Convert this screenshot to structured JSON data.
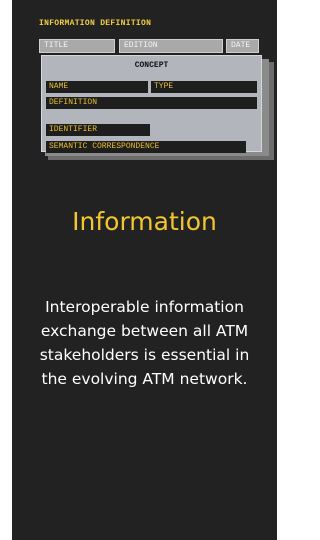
{
  "illustration": {
    "header": "INFORMATION DEFINITION",
    "top_fields": {
      "title": "TITLE",
      "edition": "EDITION",
      "date": "DATE"
    },
    "concept_title": "CONCEPT",
    "fields": {
      "name": "NAME",
      "type": "TYPE",
      "definition": "DEFINITION",
      "identifier": "IDENTIFIER",
      "semantic": "SEMANTIC CORRESPONDENCE"
    }
  },
  "card": {
    "heading": "Information",
    "description": "Interoperable information exchange between all ATM stakeholders is essential in the evolving ATM network."
  },
  "colors": {
    "card_background": "#222222",
    "accent_yellow": "#f2c62e",
    "text_white": "#ffffff"
  }
}
